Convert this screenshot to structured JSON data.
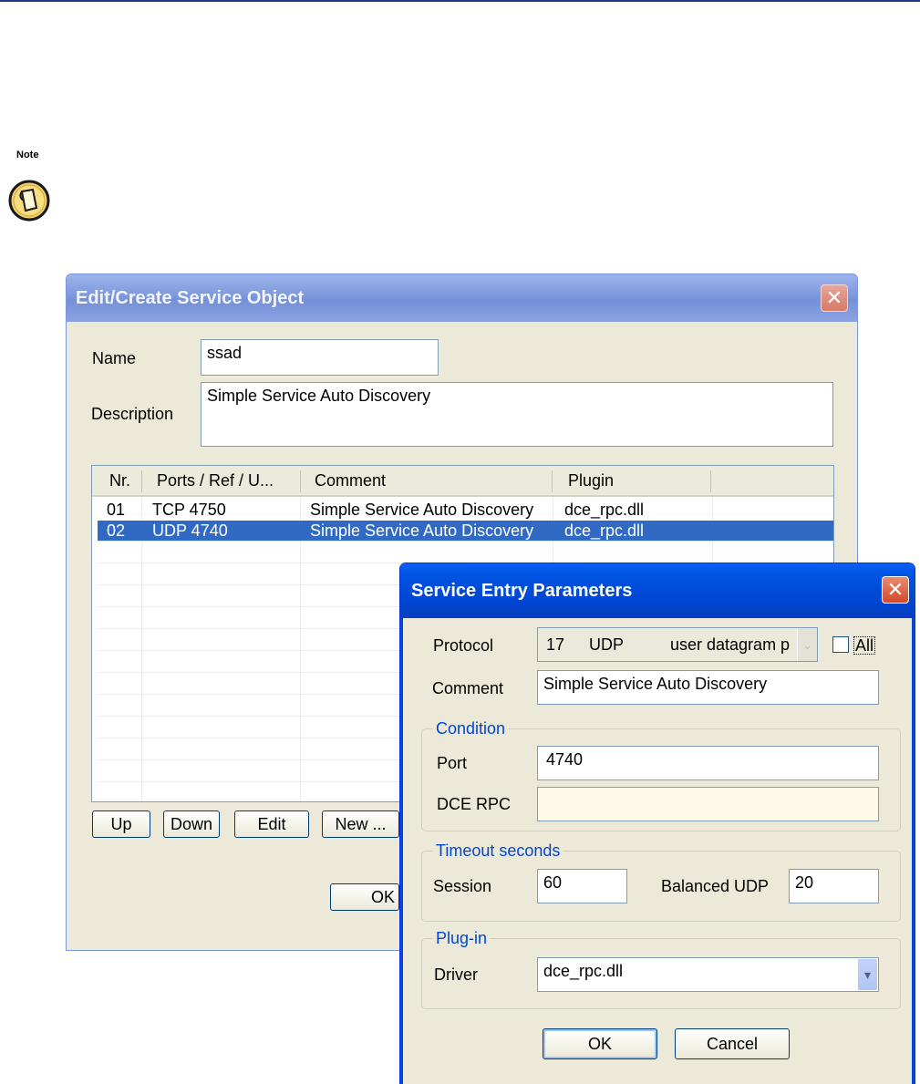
{
  "note": {
    "label": "Note"
  },
  "service_object": {
    "title": "Edit/Create Service Object",
    "name_label": "Name",
    "name_value": "ssad",
    "description_label": "Description",
    "description_value": "Simple Service Auto Discovery",
    "columns": [
      "Nr.",
      "Ports / Ref / U...",
      "Comment",
      "Plugin"
    ],
    "rows": [
      {
        "nr": "01",
        "port": "TCP  4750",
        "comment": "Simple Service Auto Discovery",
        "plugin": "dce_rpc.dll",
        "selected": false
      },
      {
        "nr": "02",
        "port": "UDP  4740",
        "comment": "Simple Service Auto Discovery",
        "plugin": "dce_rpc.dll",
        "selected": true
      }
    ],
    "buttons": {
      "up": "Up",
      "down": "Down",
      "edit": "Edit",
      "new": "New ...",
      "ok": "OK"
    }
  },
  "service_entry": {
    "title": "Service Entry Parameters",
    "protocol_label": "Protocol",
    "protocol_number": "17",
    "protocol_name": "UDP",
    "protocol_desc": "user datagram p",
    "all_label": "All",
    "comment_label": "Comment",
    "comment_value": "Simple Service Auto Discovery",
    "condition_title": "Condition",
    "port_label": "Port",
    "port_value": "4740",
    "dce_rpc_label": "DCE RPC",
    "dce_rpc_value": "",
    "timeout_title": "Timeout seconds",
    "session_label": "Session",
    "session_value": "60",
    "balanced_udp_label": "Balanced UDP",
    "balanced_udp_value": "20",
    "plugin_title": "Plug-in",
    "driver_label": "Driver",
    "driver_value": "dce_rpc.dll",
    "ok_label": "OK",
    "cancel_label": "Cancel"
  },
  "colors": {
    "selection": "#316ac5",
    "title_active": "#0054e3",
    "title_inactive": "#7d98dd",
    "group_title": "#0046d5"
  }
}
